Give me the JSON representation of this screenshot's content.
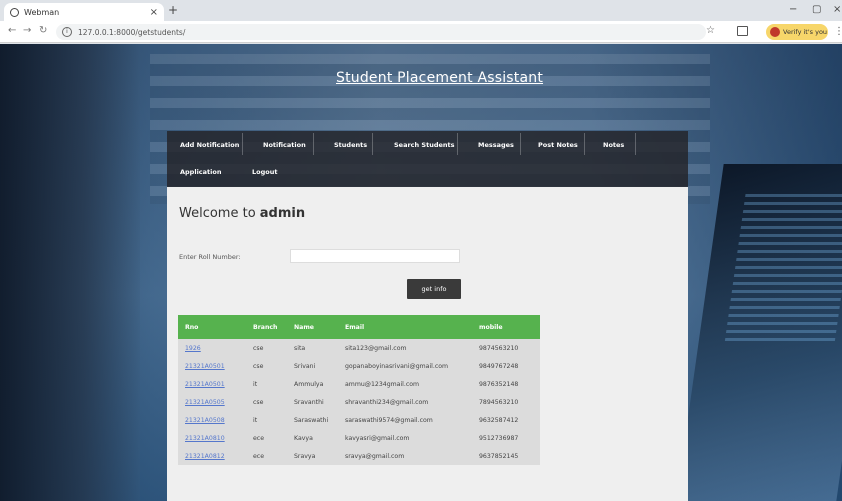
{
  "browser": {
    "tab_title": "Webman",
    "tab_close": "×",
    "new_tab": "+",
    "url": "127.0.0.1:8000/getstudents/",
    "verify_label": "Verify it's you",
    "win_minimize": "−",
    "win_restore": "▢",
    "win_close": "×",
    "back": "←",
    "forward": "→",
    "reload": "↻",
    "star": "☆",
    "kebab": "⋮"
  },
  "site": {
    "title": "Student Placement Assistant"
  },
  "nav": {
    "items": [
      "Add Notification",
      "Notification",
      "Students",
      "Search Students",
      "Messages",
      "Post Notes",
      "Notes",
      "Application",
      "Logout"
    ]
  },
  "main": {
    "welcome_prefix": "Welcome to ",
    "welcome_user": "admin",
    "roll_label": "Enter Roll Number:",
    "roll_value": "",
    "getinfo_label": "get info"
  },
  "table": {
    "headers": [
      "Rno",
      "Branch",
      "Name",
      "Email",
      "mobile"
    ],
    "rows": [
      [
        "1926",
        "cse",
        "sita",
        "sita123@gmail.com",
        "9874563210"
      ],
      [
        "21321A0501",
        "cse",
        "Srivani",
        "gopanaboyinasrivani@gmail.com",
        "9849767248"
      ],
      [
        "21321A0501",
        "it",
        "Ammulya",
        "ammu@1234gmail.com",
        "9876352148"
      ],
      [
        "21321A0505",
        "cse",
        "Sravanthi",
        "shravanthi234@gmail.com",
        "7894563210"
      ],
      [
        "21321A0508",
        "it",
        "Saraswathi",
        "saraswathi9574@gmail.com",
        "9632587412"
      ],
      [
        "21321A0810",
        "ece",
        "Kavya",
        "kavyasri@gmail.com",
        "9512736987"
      ],
      [
        "21321A0812",
        "ece",
        "Sravya",
        "sravya@gmail.com",
        "9637852145"
      ]
    ]
  }
}
